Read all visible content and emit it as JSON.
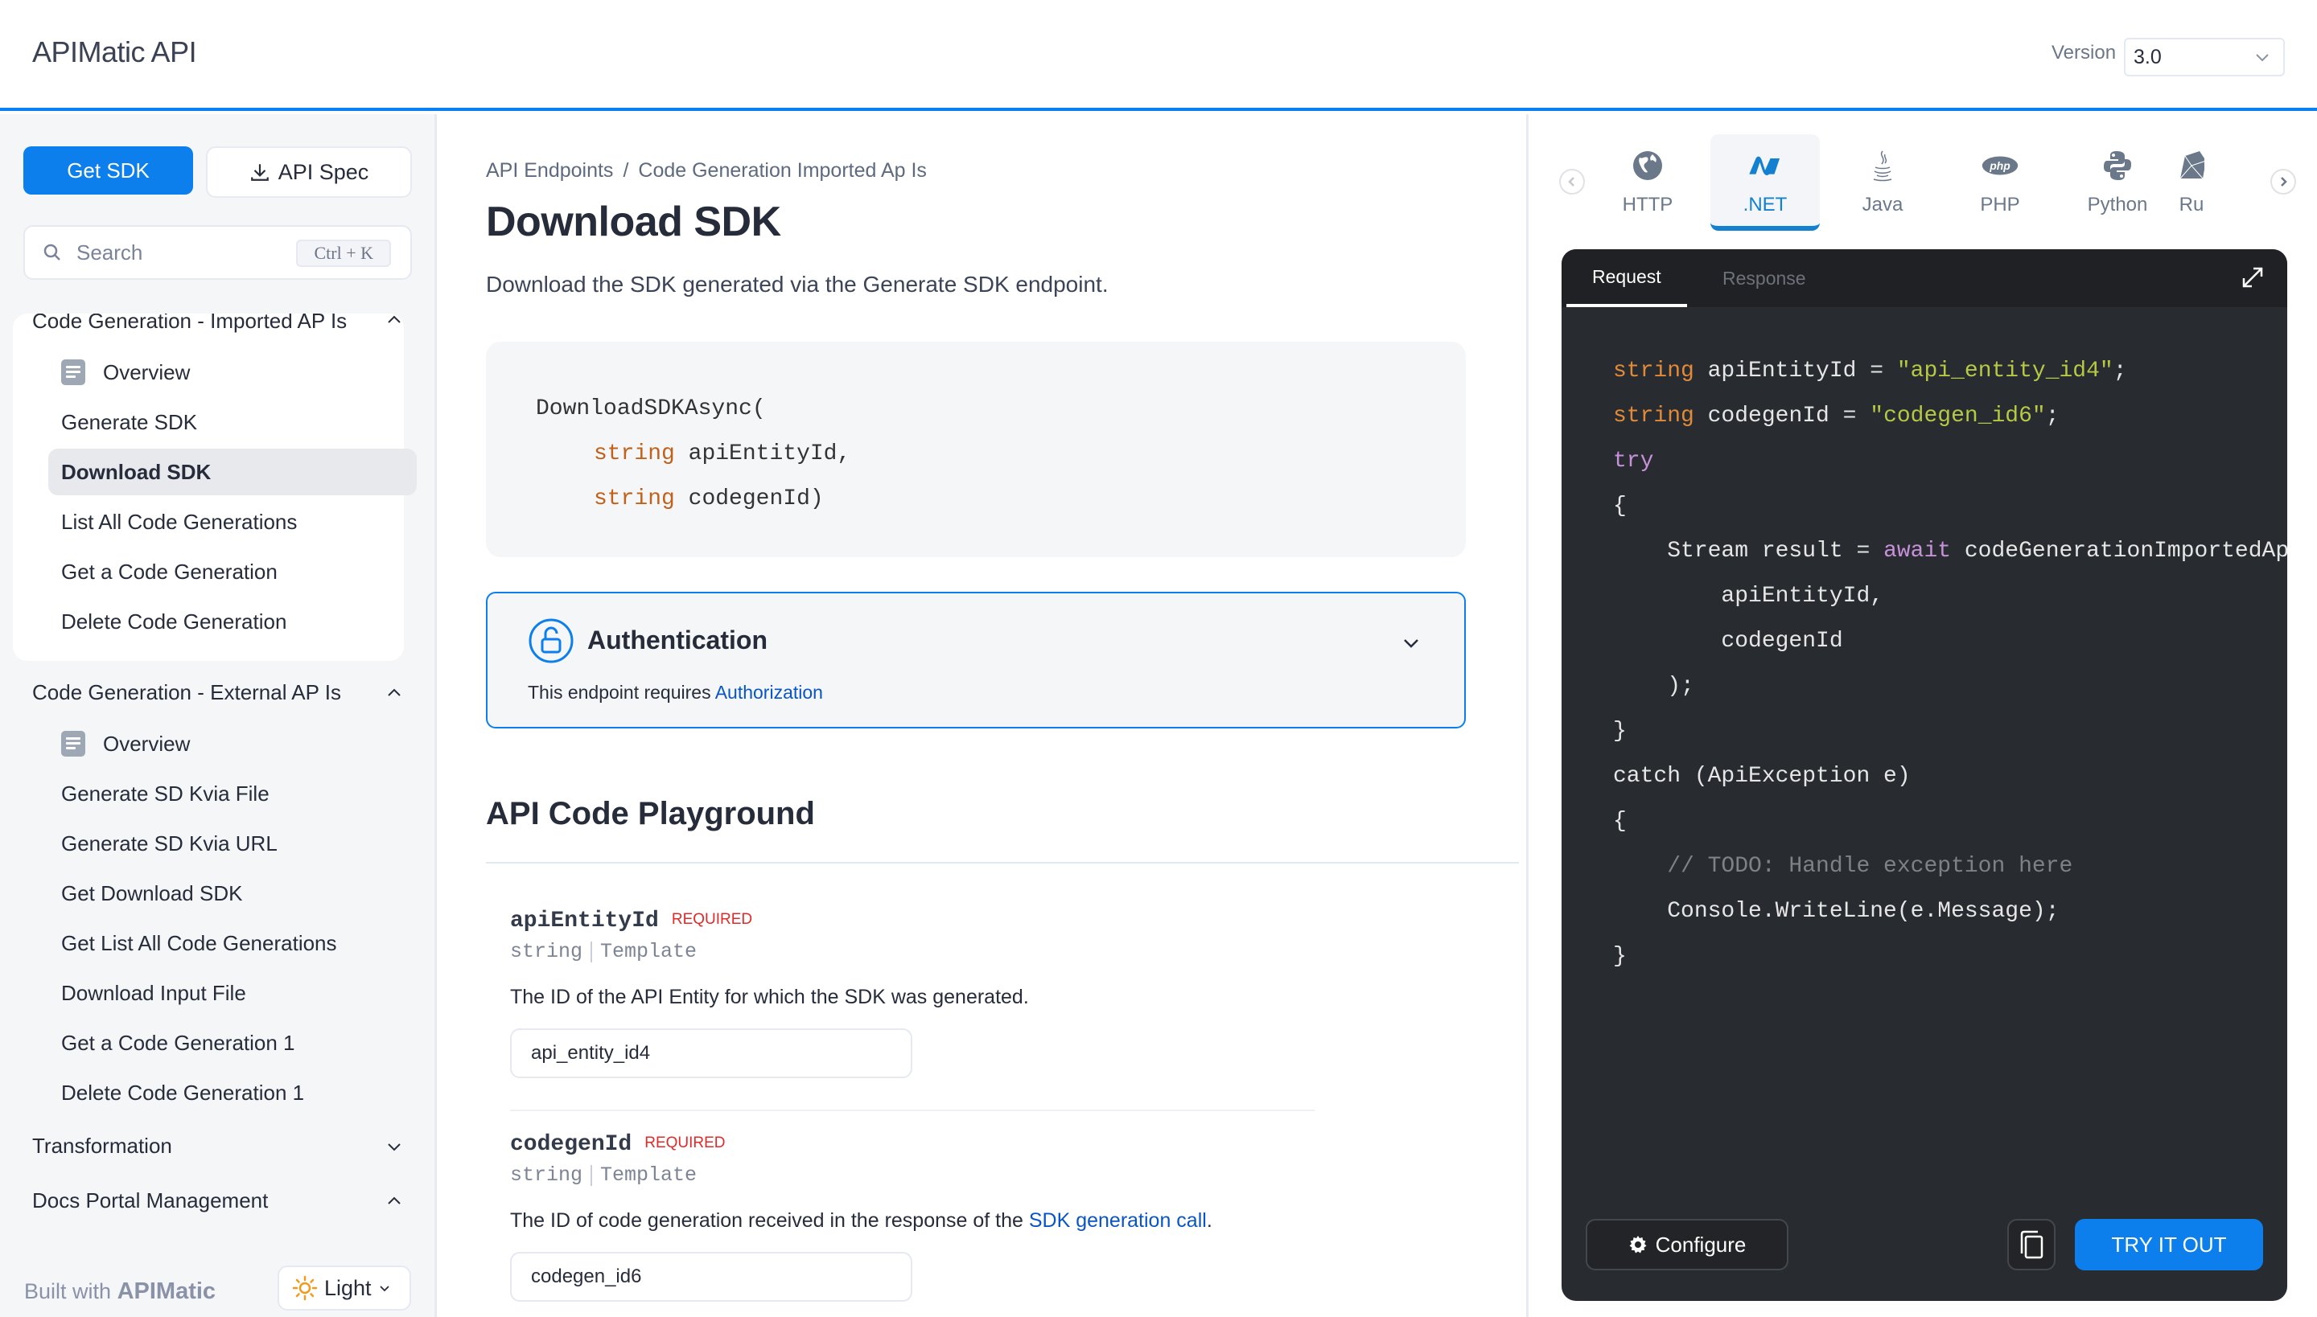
{
  "header": {
    "app_title": "APIMatic API",
    "version_label": "Version",
    "version_value": "3.0"
  },
  "sidebar": {
    "get_sdk_label": "Get SDK",
    "api_spec_label": "API Spec",
    "search_placeholder": "Search",
    "search_shortcut": "Ctrl + K",
    "groups": [
      {
        "title": "Code Generation - Imported AP Is",
        "expanded": true,
        "items": [
          {
            "label": "Overview",
            "icon": "doc-icon"
          },
          {
            "label": "Generate SDK"
          },
          {
            "label": "Download SDK",
            "active": true
          },
          {
            "label": "List All Code Generations"
          },
          {
            "label": "Get a Code Generation"
          },
          {
            "label": "Delete Code Generation"
          }
        ]
      },
      {
        "title": "Code Generation - External AP Is",
        "expanded": true,
        "items": [
          {
            "label": "Overview",
            "icon": "doc-icon"
          },
          {
            "label": "Generate SD Kvia File"
          },
          {
            "label": "Generate SD Kvia URL"
          },
          {
            "label": "Get Download SDK"
          },
          {
            "label": "Get List All Code Generations"
          },
          {
            "label": "Download Input File"
          },
          {
            "label": "Get a Code Generation 1"
          },
          {
            "label": "Delete Code Generation 1"
          }
        ]
      },
      {
        "title": "Transformation",
        "expanded": false
      },
      {
        "title": "Docs Portal Management",
        "expanded": true
      }
    ],
    "footer": {
      "built_with": "Built with",
      "brand": "APIMatic",
      "theme_label": "Light"
    }
  },
  "main": {
    "breadcrumb": [
      "API Endpoints",
      "/",
      "Code Generation Imported Ap Is"
    ],
    "title": "Download SDK",
    "description": "Download the SDK generated via the Generate SDK endpoint.",
    "signature": {
      "method": "DownloadSDKAsync(",
      "params": [
        {
          "type": "string",
          "name": "apiEntityId,"
        },
        {
          "type": "string",
          "name": "codegenId)"
        }
      ]
    },
    "auth": {
      "title": "Authentication",
      "text": "This endpoint requires ",
      "link": "Authorization"
    },
    "playground_title": "API Code Playground",
    "params": [
      {
        "name": "apiEntityId",
        "required": "REQUIRED",
        "type": "string",
        "kind": "Template",
        "description": "The ID of the API Entity for which the SDK was generated.",
        "value": "api_entity_id4"
      },
      {
        "name": "codegenId",
        "required": "REQUIRED",
        "type": "string",
        "kind": "Template",
        "description": "The ID of code generation received in the response of the ",
        "description_link": "SDK generation call",
        "description_end": ".",
        "value": "codegen_id6"
      }
    ]
  },
  "right": {
    "languages": [
      {
        "label": "HTTP",
        "icon": "globe-icon"
      },
      {
        "label": ".NET",
        "icon": "dotnet-icon",
        "active": true
      },
      {
        "label": "Java",
        "icon": "java-icon"
      },
      {
        "label": "PHP",
        "icon": "php-icon"
      },
      {
        "label": "Python",
        "icon": "python-icon"
      },
      {
        "label": "Ru",
        "icon": "ruby-icon"
      }
    ],
    "code_tabs": {
      "request": "Request",
      "response": "Response"
    },
    "code_lines": [
      [
        {
          "c": "t",
          "v": "string"
        },
        {
          "c": "",
          "v": " apiEntityId = "
        },
        {
          "c": "s",
          "v": "\"api_entity_id4\""
        },
        {
          "c": "",
          "v": ";"
        }
      ],
      [
        {
          "c": "t",
          "v": "string"
        },
        {
          "c": "",
          "v": " codegenId = "
        },
        {
          "c": "s",
          "v": "\"codegen_id6\""
        },
        {
          "c": "",
          "v": ";"
        }
      ],
      [
        {
          "c": "k",
          "v": "try"
        }
      ],
      [
        {
          "c": "",
          "v": "{"
        }
      ],
      [
        {
          "c": "",
          "v": "    Stream result = "
        },
        {
          "c": "k",
          "v": "await"
        },
        {
          "c": "",
          "v": " codeGenerationImportedApIsController.DownloadSDKAsync("
        }
      ],
      [
        {
          "c": "",
          "v": "        apiEntityId,"
        }
      ],
      [
        {
          "c": "",
          "v": "        codegenId"
        }
      ],
      [
        {
          "c": "",
          "v": "    );"
        }
      ],
      [
        {
          "c": "",
          "v": "}"
        }
      ],
      [
        {
          "c": "",
          "v": "catch (ApiException e)"
        }
      ],
      [
        {
          "c": "",
          "v": "{"
        }
      ],
      [
        {
          "c": "c",
          "v": "    // TODO: Handle exception here"
        }
      ],
      [
        {
          "c": "",
          "v": "    Console.WriteLine(e.Message);"
        }
      ],
      [
        {
          "c": "",
          "v": "}"
        }
      ]
    ],
    "configure_label": "Configure",
    "try_it_label": "TRY IT OUT"
  },
  "colors": {
    "accent": "#0c7fec",
    "dotnet_blue": "#1480d0",
    "required_red": "#e02a2a",
    "code_bg": "#282b2f"
  }
}
